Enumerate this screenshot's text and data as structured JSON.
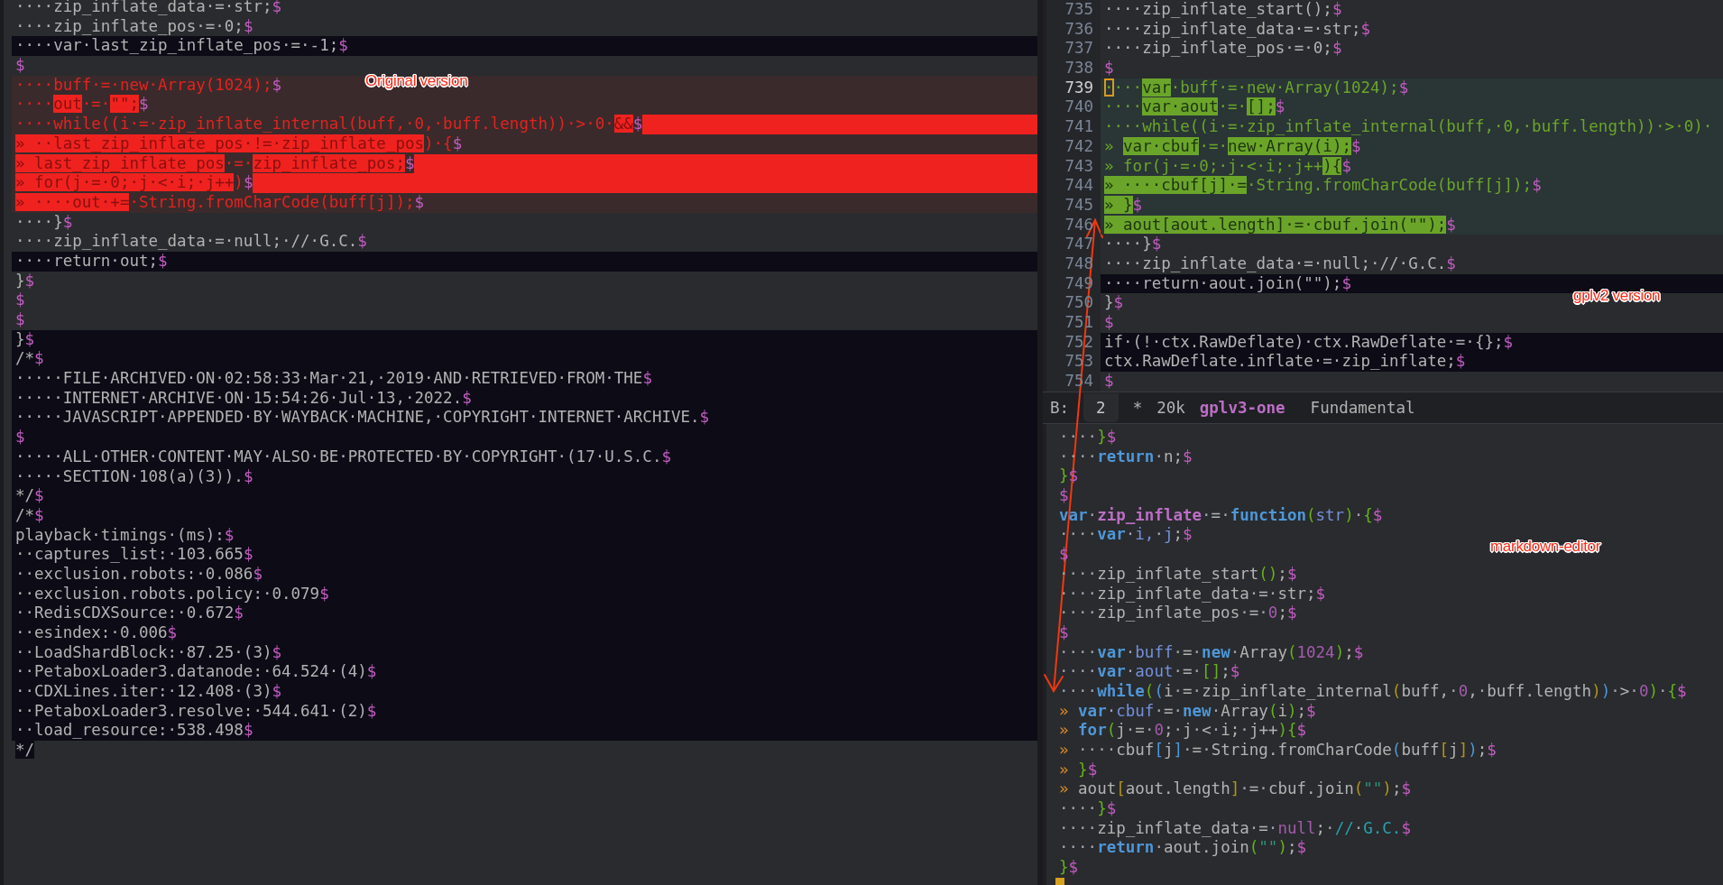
{
  "left_pane": {
    "lines": [
      {
        "segments": [
          "····zip_inflate_data·=·str;",
          {
            "text": "$",
            "kind": "eol"
          }
        ]
      },
      {
        "segments": [
          "····zip_inflate_pos·=·0;",
          {
            "text": "$",
            "kind": "eol"
          }
        ]
      },
      {
        "kind": "dark",
        "segments": [
          "····var·last_zip_inflate_pos·=·-1;",
          {
            "text": "$",
            "kind": "eol"
          }
        ]
      },
      {
        "segments": [
          {
            "text": "$",
            "kind": "eol"
          }
        ]
      },
      {
        "kind": "removed",
        "segments": [
          "····buff·=·new·Array(1024);",
          {
            "text": "$",
            "kind": "eol"
          }
        ]
      },
      {
        "kind": "removed",
        "segments": [
          "····",
          {
            "text": "out",
            "kind": "mark"
          },
          "·=·",
          {
            "text": "\"\";",
            "kind": "mark"
          },
          {
            "text": "$",
            "kind": "eol"
          }
        ]
      },
      {
        "kind": "removed-tail",
        "segments": [
          "····while((i·=·zip_inflate_internal(buff,·0,·buff.length))·>·0·",
          {
            "text": "&&",
            "kind": "mark"
          },
          {
            "text": "$",
            "kind": "eol"
          }
        ]
      },
      {
        "kind": "removed",
        "segments": [
          {
            "text": "» ··last_zip_inflate_pos·!=·zip_inflate_pos",
            "kind": "mark"
          },
          ")·{",
          {
            "text": "$",
            "kind": "eol"
          }
        ]
      },
      {
        "kind": "removed-tail",
        "segments": [
          {
            "text": "» last_zip_inflate_pos",
            "kind": "mark"
          },
          "·=·",
          {
            "text": "zip_inflate_pos;",
            "kind": "mark"
          },
          {
            "text": "$",
            "kind": "eol"
          }
        ]
      },
      {
        "kind": "removed-tail",
        "segments": [
          {
            "text": "» for(j·=·0;·j·<·i;·j++",
            "kind": "mark"
          },
          ")",
          {
            "text": "$",
            "kind": "eol"
          }
        ]
      },
      {
        "kind": "removed",
        "segments": [
          {
            "text": "» ····out·+=",
            "kind": "mark"
          },
          "·String.fromCharCode(buff[j]);",
          {
            "text": "$",
            "kind": "eol"
          }
        ]
      },
      {
        "segments": [
          "····}",
          {
            "text": "$",
            "kind": "eol"
          }
        ]
      },
      {
        "segments": [
          "····zip_inflate_data·=·null;·//·G.C.",
          {
            "text": "$",
            "kind": "eol"
          }
        ]
      },
      {
        "kind": "dark",
        "segments": [
          "····return·out;",
          {
            "text": "$",
            "kind": "eol"
          }
        ]
      },
      {
        "segments": [
          "}",
          {
            "text": "$",
            "kind": "eol"
          }
        ]
      },
      {
        "segments": [
          {
            "text": "$",
            "kind": "eol"
          }
        ]
      },
      {
        "segments": [
          {
            "text": "$",
            "kind": "eol"
          }
        ]
      },
      {
        "kind": "dark",
        "segments": [
          "}",
          {
            "text": "$",
            "kind": "eol"
          }
        ]
      },
      {
        "kind": "dark",
        "segments": [
          "/*",
          {
            "text": "$",
            "kind": "eol"
          }
        ]
      },
      {
        "kind": "dark",
        "segments": [
          "·····FILE·ARCHIVED·ON·02:58:33·Mar·21,·2019·AND·RETRIEVED·FROM·THE",
          {
            "text": "$",
            "kind": "eol"
          }
        ]
      },
      {
        "kind": "dark",
        "segments": [
          "·····INTERNET·ARCHIVE·ON·15:54:26·Jul·13,·2022.",
          {
            "text": "$",
            "kind": "eol"
          }
        ]
      },
      {
        "kind": "dark",
        "segments": [
          "·····JAVASCRIPT·APPENDED·BY·WAYBACK·MACHINE,·COPYRIGHT·INTERNET·ARCHIVE.",
          {
            "text": "$",
            "kind": "eol"
          }
        ]
      },
      {
        "kind": "dark",
        "segments": [
          {
            "text": "$",
            "kind": "eol"
          }
        ]
      },
      {
        "kind": "dark",
        "segments": [
          "·····ALL·OTHER·CONTENT·MAY·ALSO·BE·PROTECTED·BY·COPYRIGHT·(17·U.S.C.",
          {
            "text": "$",
            "kind": "eol"
          }
        ]
      },
      {
        "kind": "dark",
        "segments": [
          "·····SECTION·108(a)(3)).",
          {
            "text": "$",
            "kind": "eol"
          }
        ]
      },
      {
        "kind": "dark",
        "segments": [
          "*/",
          {
            "text": "$",
            "kind": "eol"
          }
        ]
      },
      {
        "kind": "dark",
        "segments": [
          "/*",
          {
            "text": "$",
            "kind": "eol"
          }
        ]
      },
      {
        "kind": "dark",
        "segments": [
          "playback·timings·(ms):",
          {
            "text": "$",
            "kind": "eol"
          }
        ]
      },
      {
        "kind": "dark",
        "segments": [
          "··captures_list:·103.665",
          {
            "text": "$",
            "kind": "eol"
          }
        ]
      },
      {
        "kind": "dark",
        "segments": [
          "··exclusion.robots:·0.086",
          {
            "text": "$",
            "kind": "eol"
          }
        ]
      },
      {
        "kind": "dark",
        "segments": [
          "··exclusion.robots.policy:·0.079",
          {
            "text": "$",
            "kind": "eol"
          }
        ]
      },
      {
        "kind": "dark",
        "segments": [
          "··RedisCDXSource:·0.672",
          {
            "text": "$",
            "kind": "eol"
          }
        ]
      },
      {
        "kind": "dark",
        "segments": [
          "··esindex:·0.006",
          {
            "text": "$",
            "kind": "eol"
          }
        ]
      },
      {
        "kind": "dark",
        "segments": [
          "··LoadShardBlock:·87.25·(3)",
          {
            "text": "$",
            "kind": "eol"
          }
        ]
      },
      {
        "kind": "dark",
        "segments": [
          "··PetaboxLoader3.datanode:·64.524·(4)",
          {
            "text": "$",
            "kind": "eol"
          }
        ]
      },
      {
        "kind": "dark",
        "segments": [
          "··CDXLines.iter:·12.408·(3)",
          {
            "text": "$",
            "kind": "eol"
          }
        ]
      },
      {
        "kind": "dark",
        "segments": [
          "··PetaboxLoader3.resolve:·544.641·(2)",
          {
            "text": "$",
            "kind": "eol"
          }
        ]
      },
      {
        "kind": "dark",
        "segments": [
          "··load_resource:·538.498",
          {
            "text": "$",
            "kind": "eol"
          }
        ]
      },
      {
        "segments": [
          {
            "text": "*/",
            "kind": "shade"
          }
        ]
      }
    ]
  },
  "right_top_pane": {
    "lines": [
      {
        "number": "735",
        "current": false,
        "segments": [
          "····zip_inflate_start();",
          {
            "text": "$",
            "kind": "eol"
          }
        ]
      },
      {
        "number": "736",
        "current": false,
        "segments": [
          "····zip_inflate_data·=·str;",
          {
            "text": "$",
            "kind": "eol"
          }
        ]
      },
      {
        "number": "737",
        "current": false,
        "segments": [
          "····zip_inflate_pos·=·0;",
          {
            "text": "$",
            "kind": "eol"
          }
        ]
      },
      {
        "number": "738",
        "current": false,
        "segments": [
          {
            "text": "$",
            "kind": "eol"
          }
        ]
      },
      {
        "number": "739",
        "current": true,
        "kind": "added",
        "segments": [
          {
            "text": "·",
            "kind": "cursor"
          },
          "···",
          {
            "text": "var",
            "kind": "mark"
          },
          "·buff·=·new·Array(1024);",
          {
            "text": "$",
            "kind": "eol"
          }
        ]
      },
      {
        "number": "740",
        "current": false,
        "kind": "added",
        "segments": [
          "····",
          {
            "text": "var·aout",
            "kind": "mark"
          },
          "·=·",
          {
            "text": "[];",
            "kind": "mark"
          },
          {
            "text": "$",
            "kind": "eol"
          }
        ]
      },
      {
        "number": "741",
        "current": false,
        "kind": "added",
        "segments": [
          "····while((i·=·zip_inflate_internal(buff,·0,·buff.length))·>·0)·"
        ]
      },
      {
        "number": "742",
        "current": false,
        "kind": "added",
        "segments": [
          "» ",
          {
            "text": "var·cbuf",
            "kind": "mark"
          },
          "·=·",
          {
            "text": "new·Array(i);",
            "kind": "mark"
          },
          {
            "text": "$",
            "kind": "eol"
          }
        ]
      },
      {
        "number": "743",
        "current": false,
        "kind": "added",
        "segments": [
          "» for(j·=·0;·j·<·i;·j++",
          {
            "text": "){",
            "kind": "mark"
          },
          {
            "text": "$",
            "kind": "eol"
          }
        ]
      },
      {
        "number": "744",
        "current": false,
        "kind": "added",
        "segments": [
          {
            "text": "» ····cbuf[j]·=",
            "kind": "mark"
          },
          "·String.fromCharCode(buff[j]);",
          {
            "text": "$",
            "kind": "eol"
          }
        ]
      },
      {
        "number": "745",
        "current": false,
        "kind": "added",
        "segments": [
          {
            "text": "» }",
            "kind": "mark"
          },
          {
            "text": "$",
            "kind": "eol"
          }
        ]
      },
      {
        "number": "746",
        "current": false,
        "kind": "added",
        "segments": [
          {
            "text": "» aout[aout.length]·=·cbuf.join(\"\");",
            "kind": "mark"
          },
          {
            "text": "$",
            "kind": "eol"
          }
        ]
      },
      {
        "number": "747",
        "current": false,
        "segments": [
          "····}",
          {
            "text": "$",
            "kind": "eol"
          }
        ]
      },
      {
        "number": "748",
        "current": false,
        "segments": [
          "····zip_inflate_data·=·null;·//·G.C.",
          {
            "text": "$",
            "kind": "eol"
          }
        ]
      },
      {
        "number": "749",
        "current": false,
        "kind": "dark",
        "segments": [
          "····return·aout.join(\"\");",
          {
            "text": "$",
            "kind": "eol"
          }
        ]
      },
      {
        "number": "750",
        "current": false,
        "segments": [
          "}",
          {
            "text": "$",
            "kind": "eol"
          }
        ]
      },
      {
        "number": "751",
        "current": false,
        "segments": [
          {
            "text": "$",
            "kind": "eol"
          }
        ]
      },
      {
        "number": "752",
        "current": false,
        "kind": "dark",
        "segments": [
          "if·(!·ctx.RawDeflate)·ctx.RawDeflate·=·{};",
          {
            "text": "$",
            "kind": "eol"
          }
        ]
      },
      {
        "number": "753",
        "current": false,
        "kind": "dark",
        "segments": [
          "ctx.RawDeflate.inflate·=·zip_inflate;",
          {
            "text": "$",
            "kind": "eol"
          }
        ]
      },
      {
        "number": "754",
        "current": false,
        "segments": [
          {
            "text": "$",
            "kind": "eol"
          }
        ]
      }
    ]
  },
  "mode_line": {
    "label": "B:",
    "buffer_number": "2",
    "modified": "*",
    "size": "20k",
    "buffer_name": "gplv3-one",
    "major_mode": "Fundamental"
  },
  "right_bottom_pane": {
    "cursor": true,
    "lines": [
      {
        "segments": [
          "····",
          {
            "text": "}",
            "kind": "p1"
          },
          {
            "text": "$",
            "kind": "eol"
          }
        ]
      },
      {
        "segments": [
          "····",
          {
            "text": "return",
            "kind": "kw"
          },
          "·n;",
          {
            "text": "$",
            "kind": "eol"
          }
        ]
      },
      {
        "segments": [
          {
            "text": "}",
            "kind": "p1"
          },
          {
            "text": "$",
            "kind": "eol"
          }
        ]
      },
      {
        "segments": [
          {
            "text": "$",
            "kind": "eol"
          }
        ]
      },
      {
        "segments": [
          {
            "text": "var",
            "kind": "kw"
          },
          "·",
          {
            "text": "zip_inflate",
            "kind": "fn"
          },
          "·=·",
          {
            "text": "function",
            "kind": "kw"
          },
          {
            "text": "(",
            "kind": "p1"
          },
          {
            "text": "str",
            "kind": "var"
          },
          {
            "text": ")",
            "kind": "p1"
          },
          "·",
          {
            "text": "{",
            "kind": "p1"
          },
          {
            "text": "$",
            "kind": "eol"
          }
        ]
      },
      {
        "segments": [
          "····",
          {
            "text": "var",
            "kind": "kw"
          },
          "·",
          {
            "text": "i,·j",
            "kind": "var"
          },
          ";",
          {
            "text": "$",
            "kind": "eol"
          }
        ]
      },
      {
        "segments": [
          {
            "text": "$",
            "kind": "eol"
          }
        ]
      },
      {
        "segments": [
          "····zip_inflate_start",
          {
            "text": "()",
            "kind": "p1"
          },
          ";",
          {
            "text": "$",
            "kind": "eol"
          }
        ]
      },
      {
        "segments": [
          "····zip_inflate_data·=·str;",
          {
            "text": "$",
            "kind": "eol"
          }
        ]
      },
      {
        "segments": [
          "····zip_inflate_pos·=·",
          {
            "text": "0",
            "kind": "num"
          },
          ";",
          {
            "text": "$",
            "kind": "eol"
          }
        ]
      },
      {
        "segments": [
          {
            "text": "$",
            "kind": "eol"
          }
        ]
      },
      {
        "segments": [
          "····",
          {
            "text": "var",
            "kind": "kw"
          },
          "·",
          {
            "text": "buff",
            "kind": "var"
          },
          "·=·",
          {
            "text": "new",
            "kind": "kw"
          },
          "·Array",
          {
            "text": "(",
            "kind": "p1"
          },
          {
            "text": "1024",
            "kind": "num"
          },
          {
            "text": ")",
            "kind": "p1"
          },
          ";",
          {
            "text": "$",
            "kind": "eol"
          }
        ]
      },
      {
        "segments": [
          "····",
          {
            "text": "var",
            "kind": "kw"
          },
          "·",
          {
            "text": "aout",
            "kind": "var"
          },
          "·=·",
          {
            "text": "[]",
            "kind": "p1"
          },
          ";",
          {
            "text": "$",
            "kind": "eol"
          }
        ]
      },
      {
        "segments": [
          "····",
          {
            "text": "while",
            "kind": "kw"
          },
          {
            "text": "(",
            "kind": "p1"
          },
          {
            "text": "(",
            "kind": "p2"
          },
          "i·=·zip_inflate_internal",
          {
            "text": "(",
            "kind": "p3"
          },
          "buff,·",
          {
            "text": "0",
            "kind": "num"
          },
          ",·buff.length",
          {
            "text": ")",
            "kind": "p3"
          },
          {
            "text": ")",
            "kind": "p2"
          },
          "·>·",
          {
            "text": "0",
            "kind": "num"
          },
          {
            "text": ")",
            "kind": "p1"
          },
          "·",
          {
            "text": "{",
            "kind": "p1"
          },
          {
            "text": "$",
            "kind": "eol"
          }
        ]
      },
      {
        "segments": [
          {
            "text": "» ",
            "kind": "tab"
          },
          {
            "text": "var",
            "kind": "kw"
          },
          "·",
          {
            "text": "cbuf",
            "kind": "var"
          },
          "·=·",
          {
            "text": "new",
            "kind": "kw"
          },
          "·Array",
          {
            "text": "(",
            "kind": "p1"
          },
          "i",
          {
            "text": ")",
            "kind": "p1"
          },
          ";",
          {
            "text": "$",
            "kind": "eol"
          }
        ]
      },
      {
        "segments": [
          {
            "text": "» ",
            "kind": "tab"
          },
          {
            "text": "for",
            "kind": "kw"
          },
          {
            "text": "(",
            "kind": "p1"
          },
          "j·=·",
          {
            "text": "0",
            "kind": "num"
          },
          ";·j·<·i;·j++",
          {
            "text": ")",
            "kind": "p1"
          },
          {
            "text": "{",
            "kind": "p1"
          },
          {
            "text": "$",
            "kind": "eol"
          }
        ]
      },
      {
        "segments": [
          {
            "text": "» ",
            "kind": "tab"
          },
          "····cbuf",
          {
            "text": "[",
            "kind": "p2"
          },
          "j",
          {
            "text": "]",
            "kind": "p2"
          },
          "·=·String.fromCharCode",
          {
            "text": "(",
            "kind": "p2"
          },
          "buff",
          {
            "text": "[",
            "kind": "p3"
          },
          "j",
          {
            "text": "]",
            "kind": "p3"
          },
          {
            "text": ")",
            "kind": "p2"
          },
          ";",
          {
            "text": "$",
            "kind": "eol"
          }
        ]
      },
      {
        "segments": [
          {
            "text": "» ",
            "kind": "tab"
          },
          {
            "text": "}",
            "kind": "p1"
          },
          {
            "text": "$",
            "kind": "eol"
          }
        ]
      },
      {
        "segments": [
          {
            "text": "» ",
            "kind": "tab"
          },
          "aout",
          {
            "text": "[",
            "kind": "p3"
          },
          "aout.length",
          {
            "text": "]",
            "kind": "p3"
          },
          "·=·cbuf.join",
          {
            "text": "(",
            "kind": "p3"
          },
          {
            "text": "\"\"",
            "kind": "str"
          },
          {
            "text": ")",
            "kind": "p3"
          },
          ";",
          {
            "text": "$",
            "kind": "eol"
          }
        ]
      },
      {
        "segments": [
          "····",
          {
            "text": "}",
            "kind": "p1"
          },
          {
            "text": "$",
            "kind": "eol"
          }
        ]
      },
      {
        "segments": [
          "····zip_inflate_data·=·",
          {
            "text": "null",
            "kind": "num"
          },
          ";·",
          {
            "text": "//·G.C.",
            "kind": "comment"
          },
          {
            "text": "$",
            "kind": "eol"
          }
        ]
      },
      {
        "segments": [
          "····",
          {
            "text": "return",
            "kind": "kw"
          },
          "·aout.join",
          {
            "text": "(",
            "kind": "p1"
          },
          {
            "text": "\"\"",
            "kind": "str"
          },
          {
            "text": ")",
            "kind": "p1"
          },
          ";",
          {
            "text": "$",
            "kind": "eol"
          }
        ]
      },
      {
        "segments": [
          {
            "text": "}",
            "kind": "p1"
          },
          {
            "text": "$",
            "kind": "eol"
          }
        ]
      }
    ]
  },
  "annotations": [
    {
      "text": "Original version"
    },
    {
      "text": "gplv2 version"
    },
    {
      "text": "markdown-editor"
    }
  ]
}
